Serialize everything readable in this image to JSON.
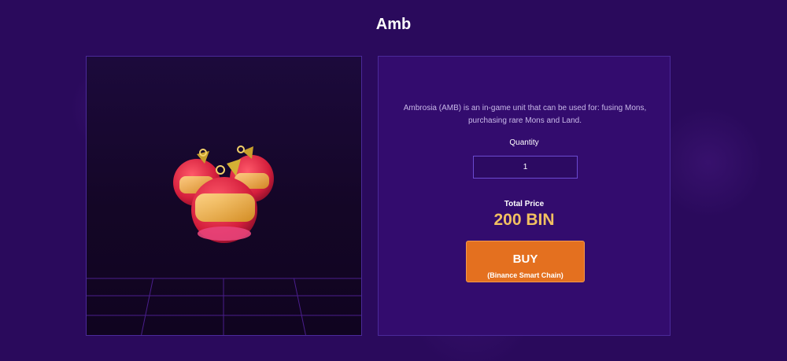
{
  "page": {
    "title": "Amb"
  },
  "product": {
    "image_icon": "ambrosia-fruit-icon",
    "description": "Ambrosia (AMB) is an in-game unit that can be used for: fusing Mons, purchasing rare Mons and Land.",
    "quantity_label": "Quantity",
    "quantity_value": "1",
    "total_label": "Total Price",
    "total_price": "200 BIN",
    "buy_label": "BUY",
    "buy_network": "(Binance Smart Chain)"
  },
  "colors": {
    "background": "#2a0a5c",
    "panel": "#330c6e",
    "accent_button": "#e4701f",
    "price_text": "#f2c061"
  }
}
